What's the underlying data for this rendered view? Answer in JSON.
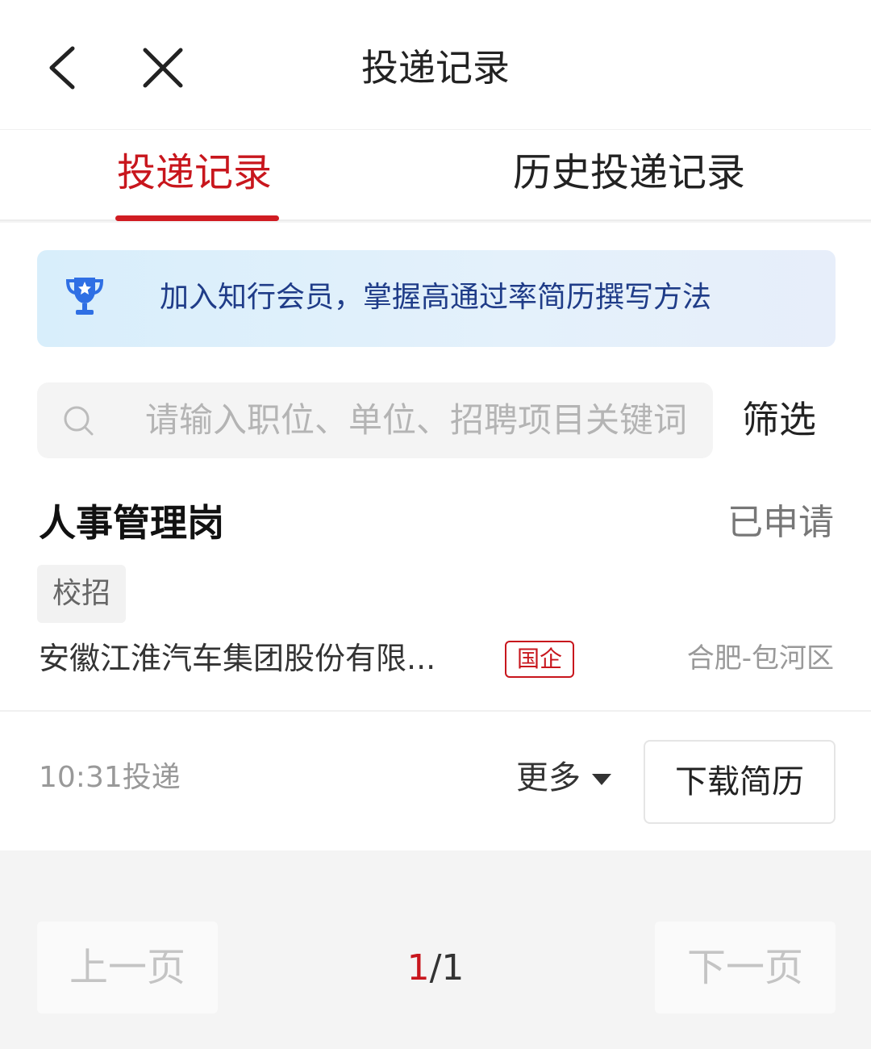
{
  "nav": {
    "title": "投递记录"
  },
  "tabs": [
    {
      "label": "投递记录",
      "active": true
    },
    {
      "label": "历史投递记录",
      "active": false
    }
  ],
  "banner": {
    "icon": "trophy-icon",
    "text": "加入知行会员，掌握高通过率简历撰写方法"
  },
  "search": {
    "placeholder": "请输入职位、单位、招聘项目关键词",
    "filter_label": "筛选"
  },
  "record": {
    "job_title": "人事管理岗",
    "status": "已申请",
    "tag": "校招",
    "company": "安徽江淮汽车集团股份有限...",
    "company_type_badge": "国企",
    "location": "合肥-包河区",
    "time": "10:31投递",
    "more_label": "更多",
    "download_label": "下载简历"
  },
  "pagination": {
    "prev_label": "上一页",
    "next_label": "下一页",
    "current": "1",
    "total": "/1"
  },
  "colors": {
    "accent": "#c8161d",
    "banner_text": "#1f3c88",
    "banner_bg": "#dcf0fb"
  }
}
